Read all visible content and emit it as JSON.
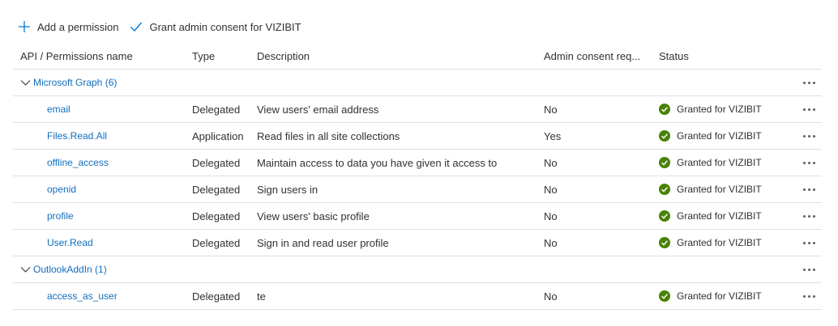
{
  "toolbar": {
    "add_label": "Add a permission",
    "grant_label": "Grant admin consent for VIZIBIT"
  },
  "columns": {
    "name": "API / Permissions name",
    "type": "Type",
    "description": "Description",
    "admin": "Admin consent req...",
    "status": "Status"
  },
  "groups": [
    {
      "label": "Microsoft Graph (6)",
      "permissions": [
        {
          "name": "email",
          "type": "Delegated",
          "description": "View users' email address",
          "admin": "No",
          "status": "Granted for VIZIBIT"
        },
        {
          "name": "Files.Read.All",
          "type": "Application",
          "description": "Read files in all site collections",
          "admin": "Yes",
          "status": "Granted for VIZIBIT"
        },
        {
          "name": "offline_access",
          "type": "Delegated",
          "description": "Maintain access to data you have given it access to",
          "admin": "No",
          "status": "Granted for VIZIBIT"
        },
        {
          "name": "openid",
          "type": "Delegated",
          "description": "Sign users in",
          "admin": "No",
          "status": "Granted for VIZIBIT"
        },
        {
          "name": "profile",
          "type": "Delegated",
          "description": "View users' basic profile",
          "admin": "No",
          "status": "Granted for VIZIBIT"
        },
        {
          "name": "User.Read",
          "type": "Delegated",
          "description": "Sign in and read user profile",
          "admin": "No",
          "status": "Granted for VIZIBIT"
        }
      ]
    },
    {
      "label": "OutlookAddIn (1)",
      "permissions": [
        {
          "name": "access_as_user",
          "type": "Delegated",
          "description": "te",
          "admin": "No",
          "status": "Granted for VIZIBIT"
        }
      ]
    }
  ],
  "colors": {
    "link": "#106ebe",
    "success": "#498205",
    "border": "#e1dfdd",
    "accent": "#0078d4"
  },
  "icons": {
    "add": "plus-icon",
    "grant": "checkmark-icon",
    "expand": "chevron-down-icon",
    "status": "success-check-icon",
    "more": "more-icon"
  }
}
